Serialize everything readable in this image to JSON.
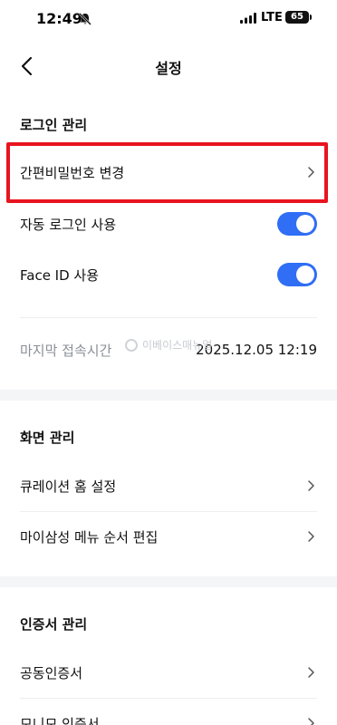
{
  "status_bar": {
    "time": "12:49",
    "network": "LTE",
    "battery": "65"
  },
  "header": {
    "title": "설정"
  },
  "login_section": {
    "title": "로그인 관리",
    "change_password": "간편비밀번호 변경",
    "auto_login": "자동 로그인 사용",
    "auto_login_on": true,
    "face_id": "Face ID 사용",
    "face_id_on": true,
    "last_login_label": "마지막 접속시간",
    "last_login_value": "2025.12.05 12:19"
  },
  "watermark": {
    "text": "이베이스매뉴얼"
  },
  "screen_section": {
    "title": "화면 관리",
    "curation_home": "큐레이션 홈 설정",
    "my_samsung_menu": "마이삼성 메뉴 순서 편집"
  },
  "cert_section": {
    "title": "인증서 관리",
    "joint_cert": "공동인증서",
    "mobile_cert": "모니모 인증서"
  },
  "colors": {
    "accent": "#2f6ef5",
    "highlight": "#e8141f"
  }
}
